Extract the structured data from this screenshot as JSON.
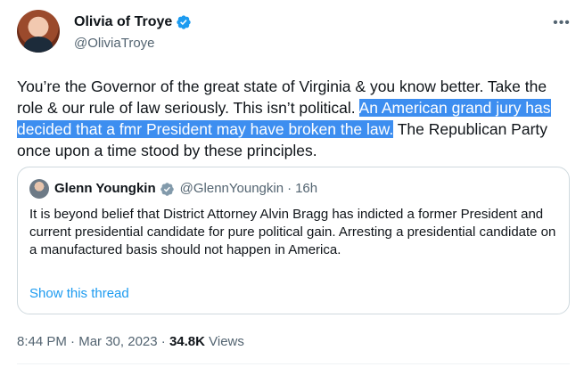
{
  "author": {
    "name": "Olivia of Troye",
    "handle": "@OliviaTroye"
  },
  "tweet": {
    "text_before": "You’re the Governor of the great state of Virginia & you know better. Take the role & our rule of law seriously. This isn’t political. ",
    "text_highlight": "An American grand jury has decided that a fmr President may have broken the law.",
    "text_after": " The Republican Party once upon a time stood by these principles."
  },
  "quoted": {
    "name": "Glenn Youngkin",
    "handle": "@GlennYoungkin",
    "separator": "·",
    "time": "16h",
    "text": "It is beyond belief that District Attorney Alvin Bragg has indicted a former President and current presidential candidate for pure political gain. Arresting a presidential candidate on a manufactured basis should not happen in America.",
    "show_thread": "Show this thread"
  },
  "meta": {
    "time": "8:44 PM",
    "separator1": " · ",
    "date": "Mar 30, 2023",
    "separator2": " · ",
    "views_count": "34.8K",
    "views_label": " Views"
  },
  "colors": {
    "accent": "#1d9bf0",
    "highlight": "#3d8ef0",
    "secondary_text": "#536471"
  },
  "icons": {
    "verified": "verified-badge-icon",
    "more": "more-options-icon"
  }
}
